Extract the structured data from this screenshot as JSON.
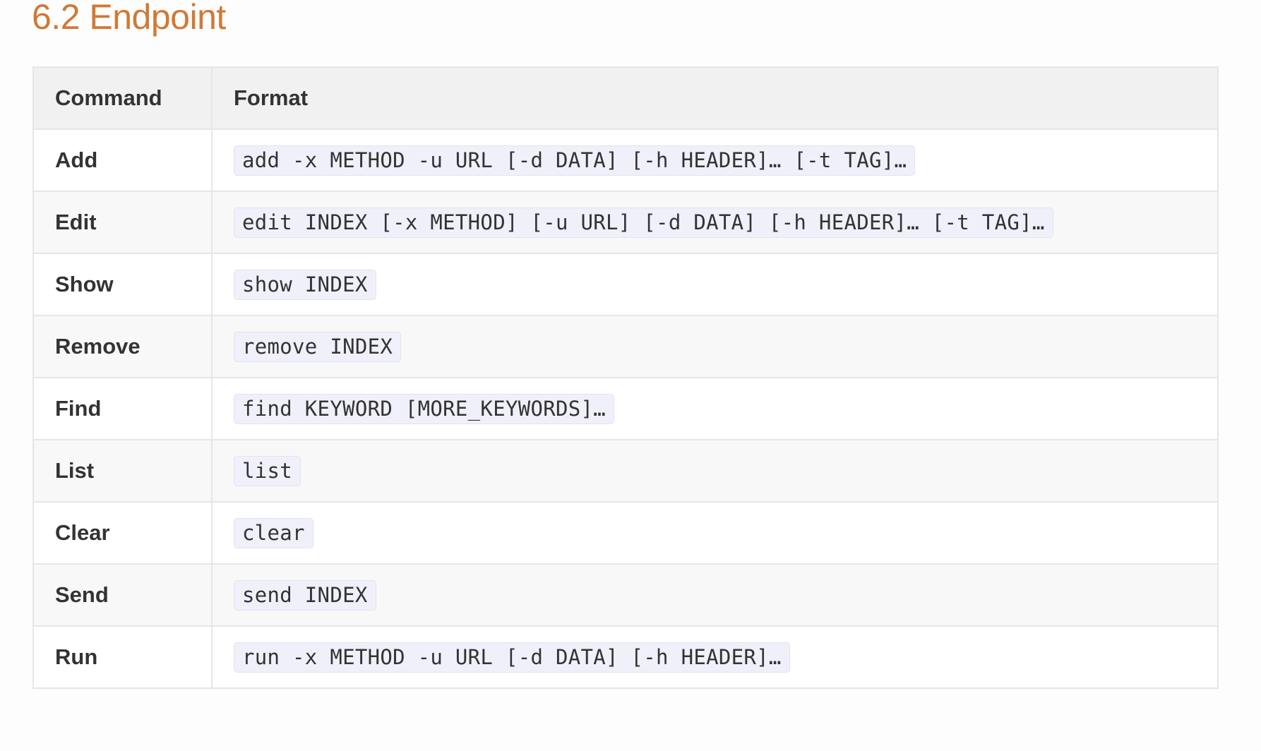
{
  "section": {
    "title": "6.2 Endpoint"
  },
  "table": {
    "headers": {
      "command": "Command",
      "format": "Format"
    },
    "rows": [
      {
        "command": "Add",
        "format": "add -x METHOD -u URL [-d DATA] [-h HEADER]… [-t TAG]…"
      },
      {
        "command": "Edit",
        "format": "edit INDEX [-x METHOD] [-u URL] [-d DATA] [-h HEADER]… [-t TAG]…"
      },
      {
        "command": "Show",
        "format": "show INDEX"
      },
      {
        "command": "Remove",
        "format": "remove INDEX"
      },
      {
        "command": "Find",
        "format": "find KEYWORD [MORE_KEYWORDS]…"
      },
      {
        "command": "List",
        "format": "list"
      },
      {
        "command": "Clear",
        "format": "clear"
      },
      {
        "command": "Send",
        "format": "send INDEX"
      },
      {
        "command": "Run",
        "format": "run -x METHOD -u URL [-d DATA] [-h HEADER]…"
      }
    ]
  }
}
